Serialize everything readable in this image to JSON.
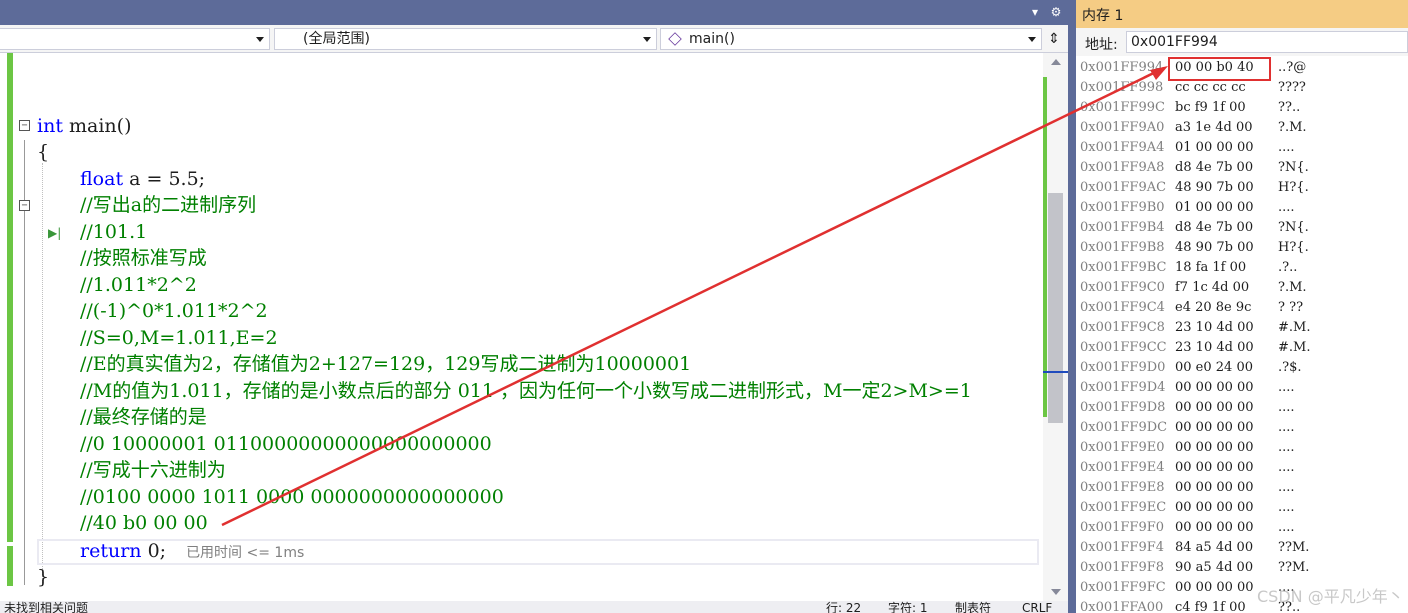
{
  "navbar": {
    "scope": "(全局范围)",
    "function": "main()"
  },
  "code": {
    "lines": [
      {
        "kw": "int",
        "rest": " main()"
      },
      {
        "rest": "{"
      },
      {
        "kw": "float",
        "rest": " a = 5.5;"
      },
      {
        "cm": "//写出a的二进制序列"
      },
      {
        "cm": "//101.1"
      },
      {
        "cm": "//按照标准写成"
      },
      {
        "cm": "//1.011*2^2"
      },
      {
        "cm": "//(-1)^0*1.011*2^2"
      },
      {
        "cm": "//S=0,M=1.011,E=2"
      },
      {
        "cm": "//E的真实值为2，存储值为2+127=129，129写成二进制为10000001"
      },
      {
        "cm": "//M的值为1.011，存储的是小数点后的部分 011 ，因为任何一个小数写成二进制形式，M一定2>M>=1"
      },
      {
        "cm": "//最终存储的是"
      },
      {
        "cm": "//0 10000001 01100000000000000000000"
      },
      {
        "cm": "//写成十六进制为"
      },
      {
        "cm": "//0100 0000 1011 0000 0000000000000000"
      },
      {
        "cm": "//40 b0 00 00"
      },
      {
        "kw": "return",
        "rest": " 0;"
      },
      {
        "rest": "}"
      }
    ],
    "perf_hint": "已用时间 <= 1ms"
  },
  "status": {
    "issues": "未找到相关问题",
    "line": "行: 22",
    "char": "字符: 1",
    "tabs": "制表符",
    "eol": "CRLF"
  },
  "memory": {
    "title": "内存 1",
    "address_label": "地址:",
    "address_value": "0x001FF994",
    "rows": [
      {
        "addr": "0x001FF994",
        "bytes": "00 00 b0 40",
        "ascii": "..?@"
      },
      {
        "addr": "0x001FF998",
        "bytes": "cc cc cc cc",
        "ascii": "????"
      },
      {
        "addr": "0x001FF99C",
        "bytes": "bc f9 1f 00",
        "ascii": "??.."
      },
      {
        "addr": "0x001FF9A0",
        "bytes": "a3 1e 4d 00",
        "ascii": "?.M."
      },
      {
        "addr": "0x001FF9A4",
        "bytes": "01 00 00 00",
        "ascii": "...."
      },
      {
        "addr": "0x001FF9A8",
        "bytes": "d8 4e 7b 00",
        "ascii": "?N{."
      },
      {
        "addr": "0x001FF9AC",
        "bytes": "48 90 7b 00",
        "ascii": "H?{."
      },
      {
        "addr": "0x001FF9B0",
        "bytes": "01 00 00 00",
        "ascii": "...."
      },
      {
        "addr": "0x001FF9B4",
        "bytes": "d8 4e 7b 00",
        "ascii": "?N{."
      },
      {
        "addr": "0x001FF9B8",
        "bytes": "48 90 7b 00",
        "ascii": "H?{."
      },
      {
        "addr": "0x001FF9BC",
        "bytes": "18 fa 1f 00",
        "ascii": ".?.."
      },
      {
        "addr": "0x001FF9C0",
        "bytes": "f7 1c 4d 00",
        "ascii": "?.M."
      },
      {
        "addr": "0x001FF9C4",
        "bytes": "e4 20 8e 9c",
        "ascii": "? ??"
      },
      {
        "addr": "0x001FF9C8",
        "bytes": "23 10 4d 00",
        "ascii": "#.M."
      },
      {
        "addr": "0x001FF9CC",
        "bytes": "23 10 4d 00",
        "ascii": "#.M."
      },
      {
        "addr": "0x001FF9D0",
        "bytes": "00 e0 24 00",
        "ascii": ".?$."
      },
      {
        "addr": "0x001FF9D4",
        "bytes": "00 00 00 00",
        "ascii": "...."
      },
      {
        "addr": "0x001FF9D8",
        "bytes": "00 00 00 00",
        "ascii": "...."
      },
      {
        "addr": "0x001FF9DC",
        "bytes": "00 00 00 00",
        "ascii": "...."
      },
      {
        "addr": "0x001FF9E0",
        "bytes": "00 00 00 00",
        "ascii": "...."
      },
      {
        "addr": "0x001FF9E4",
        "bytes": "00 00 00 00",
        "ascii": "...."
      },
      {
        "addr": "0x001FF9E8",
        "bytes": "00 00 00 00",
        "ascii": "...."
      },
      {
        "addr": "0x001FF9EC",
        "bytes": "00 00 00 00",
        "ascii": "...."
      },
      {
        "addr": "0x001FF9F0",
        "bytes": "00 00 00 00",
        "ascii": "...."
      },
      {
        "addr": "0x001FF9F4",
        "bytes": "84 a5 4d 00",
        "ascii": "??M."
      },
      {
        "addr": "0x001FF9F8",
        "bytes": "90 a5 4d 00",
        "ascii": "??M."
      },
      {
        "addr": "0x001FF9FC",
        "bytes": "00 00 00 00",
        "ascii": "...."
      },
      {
        "addr": "0x001FFA00",
        "bytes": "c4 f9 1f 00",
        "ascii": "??.."
      }
    ]
  },
  "watermark": "CSDN @平凡少年丶",
  "colors": {
    "keyword": "#0000ff",
    "comment": "#008000",
    "annotation": "#e03030",
    "memory_title": "#f5cc84"
  },
  "icons": [
    "fold-minus-icon",
    "step-arrow-icon",
    "function-icon",
    "split-icon",
    "chevron-down-icon",
    "pin-icon",
    "close-icon"
  ]
}
